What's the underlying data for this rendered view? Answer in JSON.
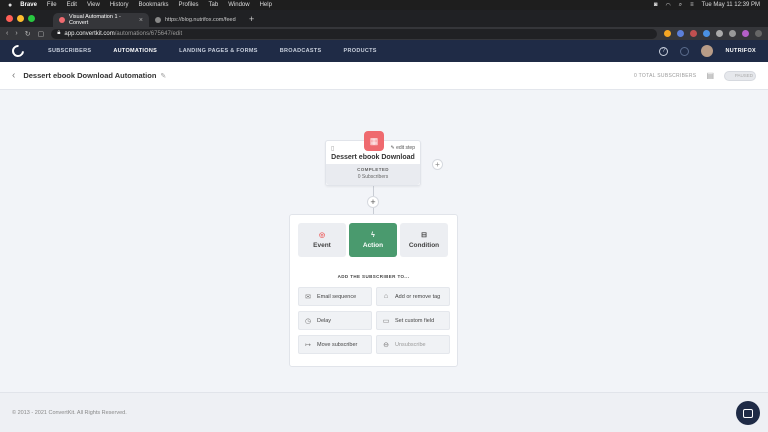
{
  "mac_menu": {
    "app": "Brave",
    "items": [
      "File",
      "Edit",
      "View",
      "History",
      "Bookmarks",
      "Profiles",
      "Tab",
      "Window",
      "Help"
    ],
    "clock": "Tue May 11  12:39 PM"
  },
  "browser": {
    "tabs": [
      {
        "title": "Visual Automation 1 - Convert",
        "active": true
      },
      {
        "title": "https://blog.nutrifox.com/feed",
        "active": false
      }
    ],
    "new_tab": "+",
    "url_host": "app.convertkit.com",
    "url_path": "/automations/675647/edit"
  },
  "app_nav": {
    "links": [
      "SUBSCRIBERS",
      "AUTOMATIONS",
      "LANDING PAGES & FORMS",
      "BROADCASTS",
      "PRODUCTS"
    ],
    "active": "AUTOMATIONS",
    "help": "?",
    "user": "NUTRIFOX"
  },
  "header": {
    "title": "Dessert ebook Download Automation",
    "total_subscribers": "0 TOTAL SUBSCRIBERS",
    "toggle_label": "PAUSED"
  },
  "trigger": {
    "title": "Dessert ebook Download",
    "edit_label": "edit step",
    "status": "COMPLETED",
    "count": "0 Subscribers"
  },
  "step_panel": {
    "types": [
      "Event",
      "Action",
      "Condition"
    ],
    "active_type": "Action",
    "add_label": "ADD THE SUBSCRIBER TO...",
    "actions": [
      {
        "label": "Email sequence",
        "icon": "email-icon",
        "enabled": true
      },
      {
        "label": "Add or remove tag",
        "icon": "tag-icon",
        "enabled": true
      },
      {
        "label": "Delay",
        "icon": "clock-icon",
        "enabled": true
      },
      {
        "label": "Set custom field",
        "icon": "field-icon",
        "enabled": true
      },
      {
        "label": "Move subscriber",
        "icon": "move-icon",
        "enabled": true
      },
      {
        "label": "Unsubscribe",
        "icon": "unsubscribe-icon",
        "enabled": false
      }
    ]
  },
  "footer": {
    "copyright": "© 2013 - 2021 ConvertKit. All Rights Reserved."
  }
}
